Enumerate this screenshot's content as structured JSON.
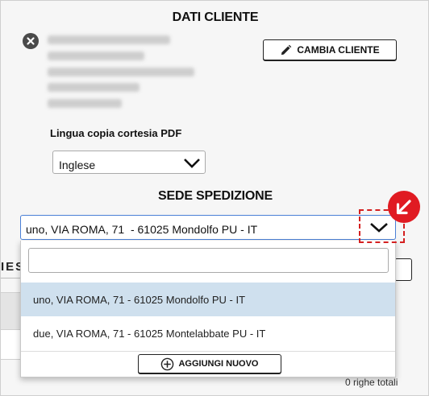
{
  "header": {
    "title": "DATI CLIENTE"
  },
  "client": {
    "remove_icon": "close-circle-icon",
    "change_button": {
      "label": "CAMBIA CLIENTE",
      "icon": "pencil-icon"
    }
  },
  "language": {
    "label": "Lingua copia cortesia PDF",
    "selected": "Inglese"
  },
  "shipping": {
    "title": "SEDE SPEDIZIONE",
    "selected": "uno, VIA ROMA, 71  - 61025 Mondolfo PU - IT",
    "search_value": "",
    "options": [
      {
        "label": "uno, VIA ROMA, 71 - 61025 Mondolfo PU - IT",
        "highlighted": true
      },
      {
        "label": "due, VIA ROMA, 71 - 61025 Montelabbate PU - IT",
        "highlighted": false
      }
    ],
    "add_button": {
      "label": "AGGIUNGI NUOVO",
      "icon": "plus-circle-icon"
    }
  },
  "background": {
    "partial_heading": "IES",
    "row_count": "0 righe totali"
  },
  "annotation": {
    "color": "#e01b22",
    "icon": "arrow-down-left-icon"
  },
  "colors": {
    "focus_border": "#4a7fd6",
    "option_highlight": "#cfe0ee"
  }
}
